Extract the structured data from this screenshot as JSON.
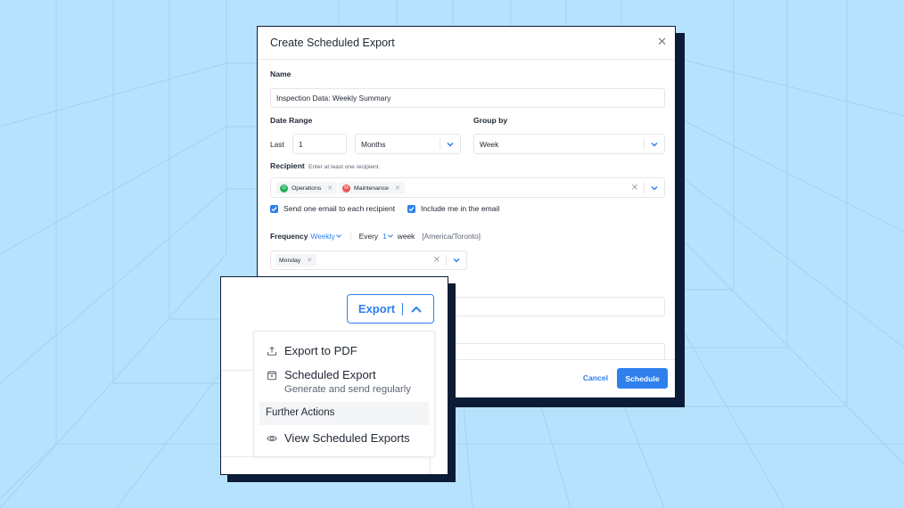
{
  "dialog": {
    "title": "Create Scheduled Export",
    "close_icon": "close-icon",
    "name": {
      "label": "Name",
      "value": "Inspection Data: Weekly Summary"
    },
    "date_range": {
      "label": "Date Range",
      "prefix": "Last",
      "amount": "1",
      "unit": "Months"
    },
    "group_by": {
      "label": "Group by",
      "value": "Week"
    },
    "recipient": {
      "label": "Recipient",
      "hint": "Enter at least one recipient.",
      "chips": [
        {
          "initial": "O",
          "label": "Operations",
          "color": "#27ae60"
        },
        {
          "initial": "M",
          "label": "Maintenance",
          "color": "#eb5757"
        }
      ]
    },
    "checkboxes": [
      {
        "label": "Send one email to each recipient",
        "checked": true
      },
      {
        "label": "Include me in the email",
        "checked": true
      }
    ],
    "frequency": {
      "label": "Frequency",
      "value": "Weekly",
      "every_label": "Every",
      "every_value": "1",
      "unit": "week",
      "timezone": "[America/Toronto]",
      "days": [
        "Monday"
      ]
    },
    "footer": {
      "cancel": "Cancel",
      "schedule": "Schedule"
    }
  },
  "export_panel": {
    "button_label": "Export",
    "menu": {
      "items": [
        {
          "icon": "upload-icon",
          "label": "Export to PDF"
        },
        {
          "icon": "calendar-icon",
          "label": "Scheduled Export",
          "sub": "Generate and send regularly"
        }
      ],
      "group_label": "Further Actions",
      "group_items": [
        {
          "icon": "eye-icon",
          "label": "View Scheduled Exports"
        }
      ]
    }
  },
  "colors": {
    "background": "#b7e2fd",
    "accent": "#2f80ed",
    "frame": "#0c1c36"
  }
}
